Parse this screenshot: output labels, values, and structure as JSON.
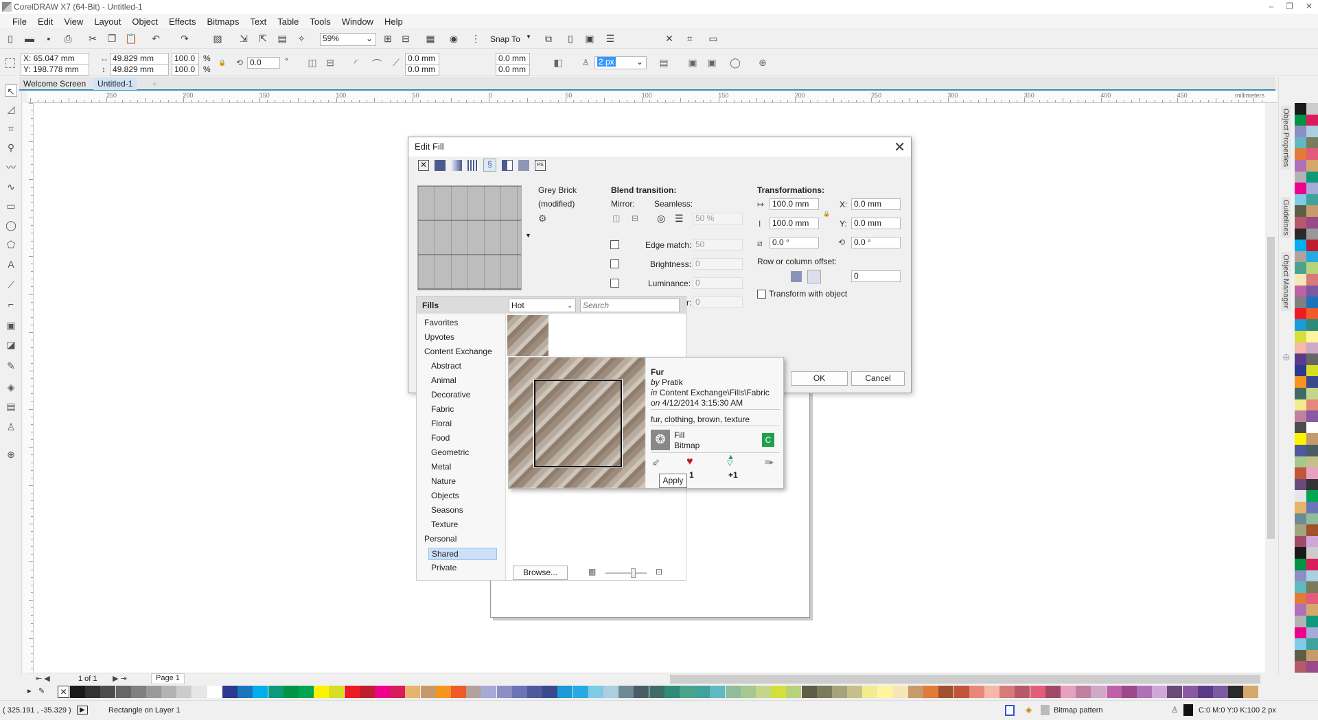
{
  "window": {
    "title": "CorelDRAW X7 (64-Bit) - Untitled-1",
    "controls": [
      "–",
      "❐",
      "✕"
    ]
  },
  "menu": [
    "File",
    "Edit",
    "View",
    "Layout",
    "Object",
    "Effects",
    "Bitmaps",
    "Text",
    "Table",
    "Tools",
    "Window",
    "Help"
  ],
  "toolbar": {
    "zoom": "59%",
    "snap_to": "Snap To"
  },
  "propbar": {
    "x": "X: 65.047 mm",
    "y": "Y: 198.778 mm",
    "width": "49.829 mm",
    "height": "49.829 mm",
    "scale_x": "100.0",
    "scale_y": "100.0",
    "percent": "%",
    "rotation": "0.0",
    "degree": "°",
    "corner_tl": "0.0 mm",
    "corner_bl": "0.0 mm",
    "corner_tr": "0.0 mm",
    "corner_br": "0.0 mm",
    "outline_width": "2 px"
  },
  "tabs": [
    {
      "label": "Welcome Screen"
    },
    {
      "label": "Untitled-1",
      "active": true
    }
  ],
  "ruler": {
    "labels": [
      "250",
      "200",
      "150",
      "100",
      "50",
      "0",
      "50",
      "100",
      "150",
      "200",
      "250",
      "300",
      "350",
      "400",
      "450"
    ],
    "unit": "millimeters"
  },
  "dockers": [
    "Object Properties",
    "Guidelines",
    "Object Manager"
  ],
  "page_nav": {
    "count": "1 of 1",
    "page": "Page 1"
  },
  "status": {
    "coords": "( 325.191 , -35.329 )",
    "object": "Rectangle on Layer 1",
    "fill": "Bitmap pattern",
    "outline": "C:0 M:0 Y:0 K:100  2 px"
  },
  "dialog": {
    "title": "Edit Fill",
    "fill_types": [
      "no-fill",
      "uniform-fill",
      "fountain-fill",
      "vector-pattern",
      "bitmap-pattern",
      "two-color-pattern",
      "texture-fill",
      "postscript-fill"
    ],
    "fill_name": "Grey Brick",
    "fill_state": "(modified)",
    "blend": {
      "heading": "Blend transition:",
      "mirror": "Mirror:",
      "seamless": "Seamless:",
      "seamless_value": "50 %",
      "edge_match": "Edge match:",
      "edge_value": "50",
      "brightness": "Brightness:",
      "brightness_value": "0",
      "luminance": "Luminance:",
      "luminance_value": "0",
      "extra_label": "r:",
      "extra_value": "0"
    },
    "transform": {
      "heading": "Transformations:",
      "width": "100.0 mm",
      "height": "100.0 mm",
      "x_label": "X:",
      "x": "0.0 mm",
      "y_label": "Y:",
      "y": "0.0 mm",
      "skew": "0.0 °",
      "rotate": "0.0 °",
      "offset_label": "Row or column offset:",
      "offset": "0",
      "transform_with_object": "Transform with object",
      "transform_checked": false
    },
    "fills": {
      "heading": "Fills",
      "sort": "Hot",
      "search_placeholder": "Search",
      "categories": [
        {
          "label": "Favorites",
          "level": 0
        },
        {
          "label": "Upvotes",
          "level": 0
        },
        {
          "label": "Content Exchange",
          "level": 0
        },
        {
          "label": "Abstract",
          "level": 1
        },
        {
          "label": "Animal",
          "level": 1
        },
        {
          "label": "Decorative",
          "level": 1
        },
        {
          "label": "Fabric",
          "level": 1
        },
        {
          "label": "Floral",
          "level": 1
        },
        {
          "label": "Food",
          "level": 1
        },
        {
          "label": "Geometric",
          "level": 1
        },
        {
          "label": "Metal",
          "level": 1
        },
        {
          "label": "Nature",
          "level": 1
        },
        {
          "label": "Objects",
          "level": 1
        },
        {
          "label": "Seasons",
          "level": 1
        },
        {
          "label": "Texture",
          "level": 1
        },
        {
          "label": "Personal",
          "level": 0
        },
        {
          "label": "Shared",
          "level": 1,
          "selected": true
        },
        {
          "label": "Private",
          "level": 1
        }
      ],
      "browse": "Browse..."
    },
    "ok": "OK",
    "cancel": "Cancel",
    "popup": {
      "name": "Fur",
      "by_prefix": "by",
      "author": "Pratik",
      "in_prefix": "in",
      "location": "Content Exchange\\Fills\\Fabric",
      "on_prefix": "on",
      "date": "4/12/2014 3:15:30 AM",
      "tags": "fur, clothing, brown, texture",
      "type1": "Fill",
      "type2": "Bitmap",
      "badge": "C",
      "likes": "1",
      "votes": "+1",
      "apply_tooltip": "Apply"
    }
  },
  "colors": {
    "accent": "#3a8fb7",
    "selected": "#cce0f7",
    "heart": "#c0161b",
    "badge": "#1fa04a",
    "palette": [
      "#1a1a1a",
      "#333333",
      "#4d4d4d",
      "#666666",
      "#808080",
      "#999999",
      "#b3b3b3",
      "#cccccc",
      "#e6e6e6",
      "#ffffff",
      "#2b3990",
      "#1c75bc",
      "#00aeef",
      "#0e9a7a",
      "#009444",
      "#00a651",
      "#fff200",
      "#d7df23",
      "#ed1c24",
      "#be1e2d",
      "#ec008c",
      "#d91c5c",
      "#e6b56b",
      "#c49a6c",
      "#f7941d",
      "#f15a29",
      "#b3a19b",
      "#a7a9d7",
      "#8c8fc5",
      "#6c74b8",
      "#4f5a9c",
      "#3b4a8c",
      "#1b9ad6",
      "#27aae1",
      "#7ecbe6",
      "#a9cfe0",
      "#6d8a96",
      "#4a5d66",
      "#3f6b66",
      "#2e8b7a",
      "#4ca38b",
      "#3fa39c",
      "#5fb9c1",
      "#8fbc9a",
      "#a6c78f",
      "#c4d68a",
      "#d5df3a",
      "#b8d27a",
      "#5e5e46",
      "#7a7a5c",
      "#a5a37c",
      "#c4c08a",
      "#f2ec8c",
      "#fff59d",
      "#f5e6b8",
      "#c79a6b",
      "#e07b39",
      "#a0522d",
      "#c0553a",
      "#e6887a",
      "#f6b8a8",
      "#d97a7a",
      "#b55a6a",
      "#e35d7a",
      "#a04a6a",
      "#e8a0c0",
      "#c080a0",
      "#d0a8c8",
      "#c060a8",
      "#9a4a8a",
      "#b070b8",
      "#d0a8d8",
      "#6a4a7a",
      "#8a5aa0",
      "#5a3a8a",
      "#7a5aa0",
      "#2a2a2a",
      "#d4a86a"
    ]
  }
}
